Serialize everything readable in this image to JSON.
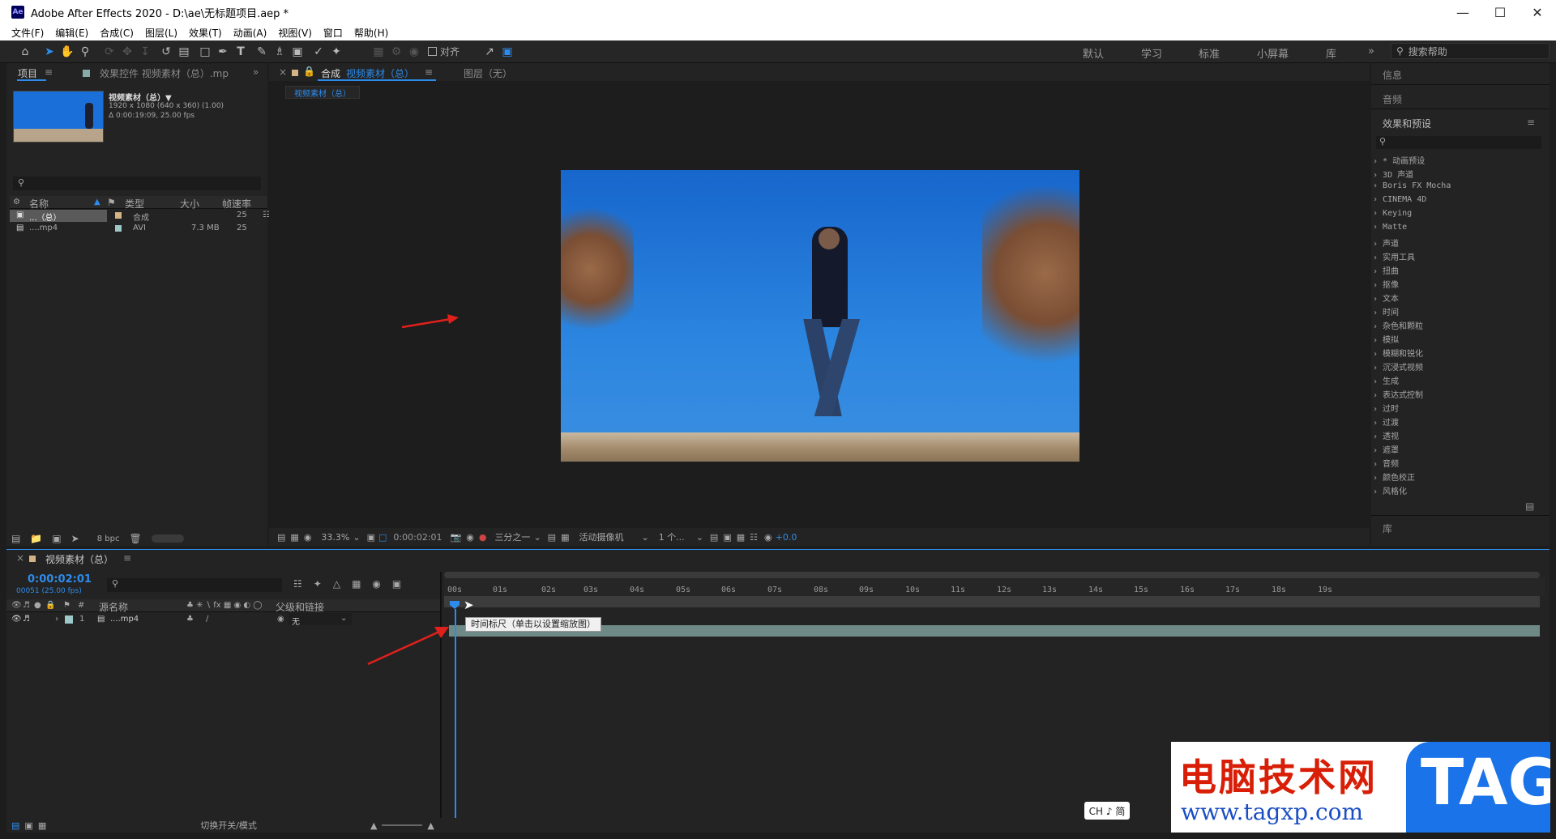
{
  "window": {
    "title": "Adobe After Effects 2020 - D:\\ae\\无标题项目.aep *",
    "app_icon": "Ae"
  },
  "menu": [
    "文件(F)",
    "编辑(E)",
    "合成(C)",
    "图层(L)",
    "效果(T)",
    "动画(A)",
    "视图(V)",
    "窗口",
    "帮助(H)"
  ],
  "toolbar": {
    "align_label": "对齐",
    "workspaces": [
      "默认",
      "学习",
      "标准",
      "小屏幕",
      "库"
    ],
    "search_placeholder": "搜索帮助"
  },
  "project": {
    "tab_project": "项目",
    "tab_effects_controls": "效果控件 视频素材（总）.mp",
    "item_name": "视频素材（总）▼",
    "item_info1": "1920 x 1080  (640 x 360) (1.00)",
    "item_info2": "Δ 0:00:19:09, 25.00 fps",
    "columns": [
      "名称",
      "类型",
      "大小",
      "帧速率"
    ],
    "rows": [
      {
        "name": "...（总）",
        "type": "合成",
        "size": "",
        "fps": "25"
      },
      {
        "name": "....mp4",
        "type": "AVI",
        "size": "7.3 MB",
        "fps": "25"
      }
    ],
    "bpc": "8 bpc"
  },
  "composition": {
    "tab_prefix": "合成",
    "tab_name": "视频素材（总）",
    "layer_tab": "图层（无）",
    "breadcrumb": "视频素材（总）",
    "zoom": "33.3%",
    "timecode": "0:00:02:01",
    "resolution": "三分之一",
    "camera": "活动摄像机",
    "views": "1 个...",
    "exposure": "+0.0"
  },
  "right_panel": {
    "info": "信息",
    "audio": "音频",
    "effects_title": "效果和预设",
    "effects": [
      "* 动画预设",
      "3D 声道",
      "Boris FX Mocha",
      "CINEMA 4D",
      "Keying",
      "Matte",
      "声道",
      "实用工具",
      "扭曲",
      "抠像",
      "文本",
      "时间",
      "杂色和颗粒",
      "模拟",
      "模糊和锐化",
      "沉浸式视频",
      "生成",
      "表达式控制",
      "过时",
      "过渡",
      "透视",
      "遮罩",
      "音频",
      "颜色校正",
      "风格化"
    ],
    "library": "库"
  },
  "timeline": {
    "tab_name": "视频素材（总）",
    "timecode": "0:00:02:01",
    "frame_info": "00051 (25.00 fps)",
    "col_source": "源名称",
    "col_parent": "父级和链接",
    "layer_index": "1",
    "layer_name": "....mp4",
    "parent_value": "无",
    "ruler_ticks": [
      "00s",
      "01s",
      "02s",
      "03s",
      "04s",
      "05s",
      "06s",
      "07s",
      "08s",
      "09s",
      "10s",
      "11s",
      "12s",
      "13s",
      "14s",
      "15s",
      "16s",
      "17s",
      "18s",
      "19s"
    ],
    "tooltip": "时间标尺（单击以设置缩放图）",
    "footer": "切换开关/模式"
  },
  "ime": "CH ♪ 简",
  "watermark": {
    "title": "电脑技术网",
    "url": "www.tagxp.com",
    "tag": "TAG"
  }
}
